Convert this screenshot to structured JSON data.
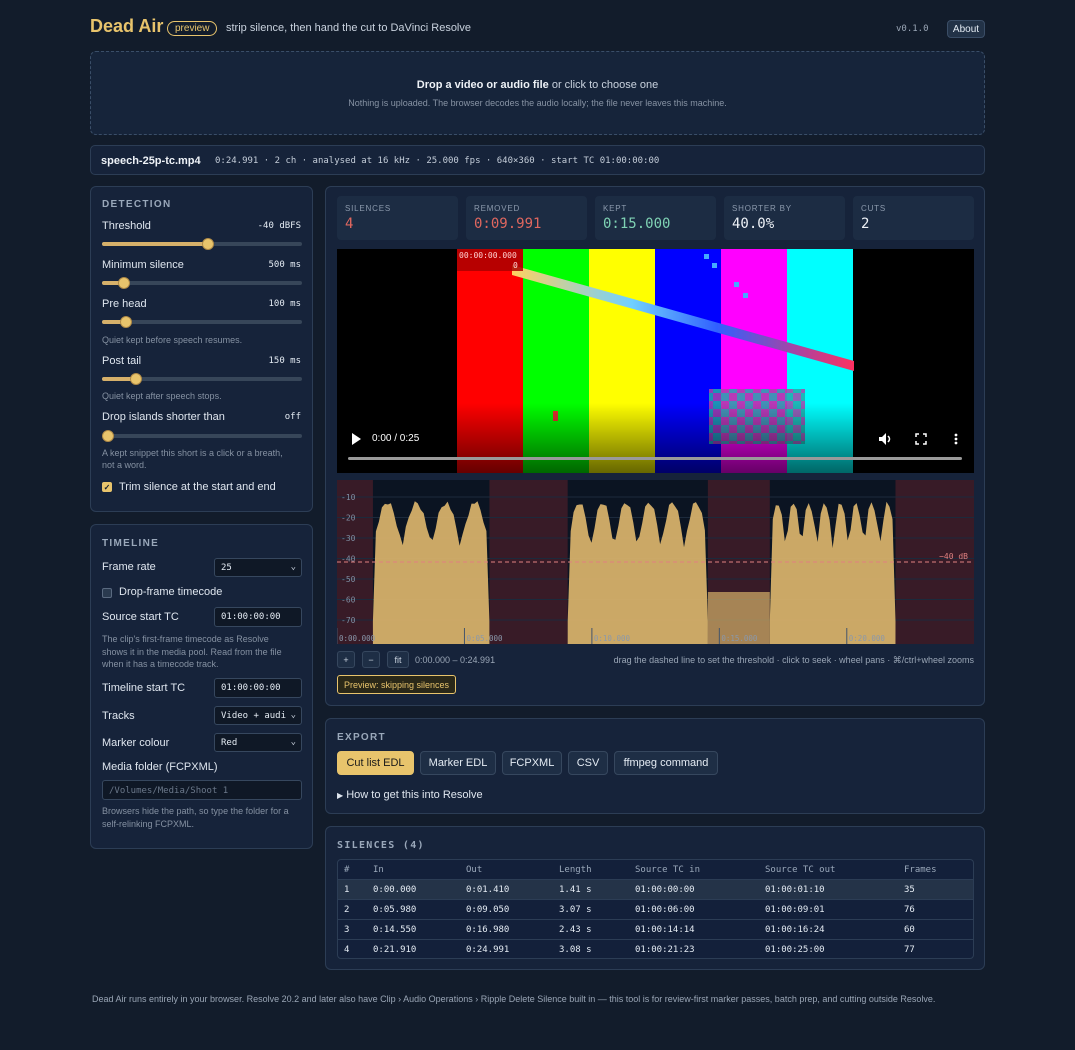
{
  "header": {
    "title": "Dead Air",
    "badge": "preview",
    "tagline": "strip silence, then hand the cut to DaVinci Resolve",
    "version": "v0.1.0",
    "about": "About"
  },
  "dropzone": {
    "strong": "Drop a video or audio file",
    "rest": " or click to choose one",
    "sub": "Nothing is uploaded. The browser decodes the audio locally; the file never leaves this machine."
  },
  "file": {
    "name": "speech-25p-tc.mp4",
    "meta": "0:24.991 · 2 ch · analysed at 16 kHz · 25.000 fps · 640×360 · start TC 01:00:00:00"
  },
  "detection": {
    "heading": "DETECTION",
    "threshold": {
      "label": "Threshold",
      "value": "-40 dBFS",
      "position": 0.53
    },
    "min_silence": {
      "label": "Minimum silence",
      "value": "500 ms",
      "position": 0.11
    },
    "pre_head": {
      "label": "Pre head",
      "value": "100 ms",
      "position": 0.12,
      "hint": "Quiet kept before speech resumes."
    },
    "post_tail": {
      "label": "Post tail",
      "value": "150 ms",
      "position": 0.17,
      "hint": "Quiet kept after speech stops."
    },
    "drop_islands": {
      "label": "Drop islands shorter than",
      "value": "off",
      "position": 0.03,
      "hint1": "A kept snippet this short is a click or a breath,",
      "hint2": "not a word."
    },
    "trim_label": "Trim silence at the start and end",
    "trim_checked": true
  },
  "timeline": {
    "heading": "TIMELINE",
    "frame_rate_label": "Frame rate",
    "frame_rate": "25",
    "drop_frame_label": "Drop-frame timecode",
    "source_tc_label": "Source start TC",
    "source_tc": "01:00:00:00",
    "source_hint1": "The clip's first-frame timecode as Resolve",
    "source_hint2": "shows it in the media pool. Read from the file",
    "source_hint3": "when it has a timecode track.",
    "timeline_tc_label": "Timeline start TC",
    "timeline_tc": "01:00:00:00",
    "tracks_label": "Tracks",
    "tracks": "Video + audi",
    "marker_label": "Marker colour",
    "marker": "Red",
    "media_label": "Media folder (FCPXML)",
    "media_placeholder": "/Volumes/Media/Shoot 1",
    "media_hint1": "Browsers hide the path, so type the folder for a",
    "media_hint2": "self-relinking FCPXML."
  },
  "stats": [
    {
      "label": "SILENCES",
      "value": "4",
      "color": "#e0675f"
    },
    {
      "label": "REMOVED",
      "value": "0:09.991",
      "color": "#e0675f"
    },
    {
      "label": "KEPT",
      "value": "0:15.000",
      "color": "#7fd2b4"
    },
    {
      "label": "SHORTER BY",
      "value": "40.0%",
      "color": "#eef2f7"
    },
    {
      "label": "CUTS",
      "value": "2",
      "color": "#eef2f7"
    }
  ],
  "video": {
    "overlay_tc": "00:00:00.000",
    "overlay_frame": "0",
    "time": "0:00 / 0:25",
    "progress": 0,
    "bar_colors": [
      "#ff0000",
      "#00ff00",
      "#ffff00",
      "#0000ff",
      "#ff00ff",
      "#00ffff"
    ]
  },
  "wave": {
    "db_ticks": [
      "-10",
      "-20",
      "-30",
      "-40",
      "-50",
      "-60",
      "-70"
    ],
    "threshold_label": "−40 dB",
    "time_ticks": [
      "0:00.000",
      "0:05.000",
      "0:10.000",
      "0:15.000",
      "0:20.000"
    ],
    "duration_s": 24.991,
    "silences": [
      {
        "start": 0.0,
        "end": 1.41
      },
      {
        "start": 5.98,
        "end": 9.05
      },
      {
        "start": 14.55,
        "end": 16.98
      },
      {
        "start": 21.91,
        "end": 24.991
      }
    ],
    "colors": {
      "wave": "#d6b06a",
      "silence": "rgba(140,40,50,0.35)",
      "threshold": "#e08080"
    }
  },
  "zoom": {
    "plus": "+",
    "minus": "−",
    "fit": "fit",
    "range": "0:00.000 – 0:24.991",
    "hint": "drag the dashed line to set the threshold · click to seek · wheel pans · ⌘/ctrl+wheel zooms"
  },
  "preview_label": "Preview: skipping silences",
  "export": {
    "heading": "EXPORT",
    "buttons": [
      "Cut list EDL",
      "Marker EDL",
      "FCPXML",
      "CSV",
      "ffmpeg command"
    ],
    "howto": "How to get this into Resolve"
  },
  "silences": {
    "heading": "SILENCES (4)",
    "columns": [
      "#",
      "In",
      "Out",
      "Length",
      "Source TC in",
      "Source TC out",
      "Frames"
    ],
    "rows": [
      [
        "1",
        "0:00.000",
        "0:01.410",
        "1.41 s",
        "01:00:00:00",
        "01:00:01:10",
        "35"
      ],
      [
        "2",
        "0:05.980",
        "0:09.050",
        "3.07 s",
        "01:00:06:00",
        "01:00:09:01",
        "76"
      ],
      [
        "3",
        "0:14.550",
        "0:16.980",
        "2.43 s",
        "01:00:14:14",
        "01:00:16:24",
        "60"
      ],
      [
        "4",
        "0:21.910",
        "0:24.991",
        "3.08 s",
        "01:00:21:23",
        "01:00:25:00",
        "77"
      ]
    ]
  },
  "footer": "Dead Air runs entirely in your browser. Resolve 20.2 and later also have Clip › Audio Operations › Ripple Delete Silence built in — this tool is for review-first marker passes, batch prep, and cutting outside Resolve."
}
